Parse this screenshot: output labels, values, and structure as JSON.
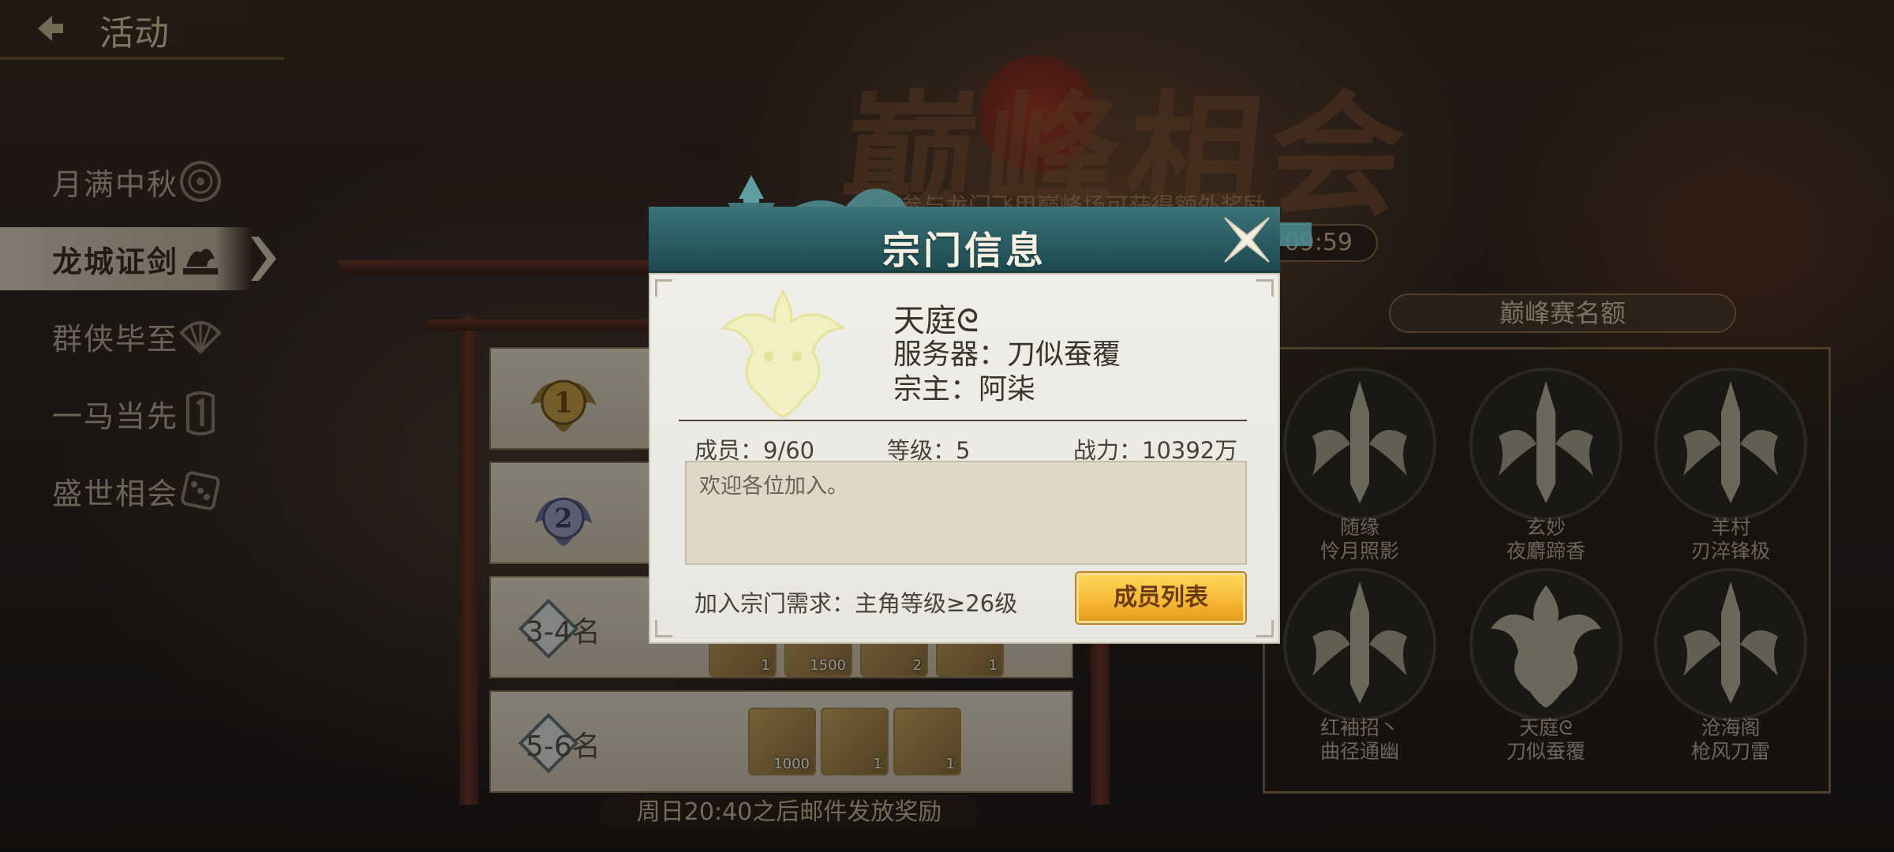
{
  "header": {
    "title": "活动"
  },
  "background": {
    "event_title": "巅峰相会",
    "event_subtitle": "参与龙门飞甲巅峰场可获得额外奖励",
    "countdown": "09:59"
  },
  "sidebar": {
    "items": [
      {
        "label": "月满中秋",
        "icon": "mooncake-icon",
        "active": false
      },
      {
        "label": "龙城证剑",
        "icon": "dragon-city-icon",
        "active": true
      },
      {
        "label": "群侠毕至",
        "icon": "fan-icon",
        "active": false
      },
      {
        "label": "一马当先",
        "icon": "number-one-icon",
        "active": false
      },
      {
        "label": "盛世相会",
        "icon": "dice-icon",
        "active": false
      }
    ]
  },
  "rewards": {
    "rows": [
      {
        "rank": "1",
        "items": []
      },
      {
        "rank": "2",
        "items": []
      },
      {
        "rank": "3-4名",
        "items": [
          {
            "count": "1"
          },
          {
            "count": "1500"
          },
          {
            "count": "2"
          },
          {
            "count": "1"
          }
        ]
      },
      {
        "rank": "5-6名",
        "items": [
          {
            "count": "1000"
          },
          {
            "count": "1"
          },
          {
            "count": "1"
          }
        ]
      }
    ],
    "notice": "周日20:40之后邮件发放奖励"
  },
  "quota": {
    "title": "巅峰赛名额",
    "slots": [
      {
        "name": "随缘",
        "server": "怜月照影"
      },
      {
        "name": "玄妙",
        "server": "夜麝蹄香"
      },
      {
        "name": "羊村",
        "server": "刃淬锋极"
      },
      {
        "name": "红袖招丶",
        "server": "曲径通幽"
      },
      {
        "name": "天庭ᘓ",
        "server": "刀似蚕覆"
      },
      {
        "name": "沧海阁",
        "server": "枪风刀雷"
      }
    ]
  },
  "modal": {
    "title": "宗门信息",
    "sect_name": "天庭ᘓ",
    "server": "服务器：刀似蚕覆",
    "leader": "宗主：阿柒",
    "members": "成员：9/60",
    "level": "等级：5",
    "power": "战力：10392万",
    "motto": "欢迎各位加入。",
    "requirement": "加入宗门需求：主角等级≥26级",
    "members_button": "成员列表"
  },
  "colors": {
    "modal_header": "#285a60",
    "button_gold": "#f6b634",
    "modal_body": "#f0eee9"
  }
}
